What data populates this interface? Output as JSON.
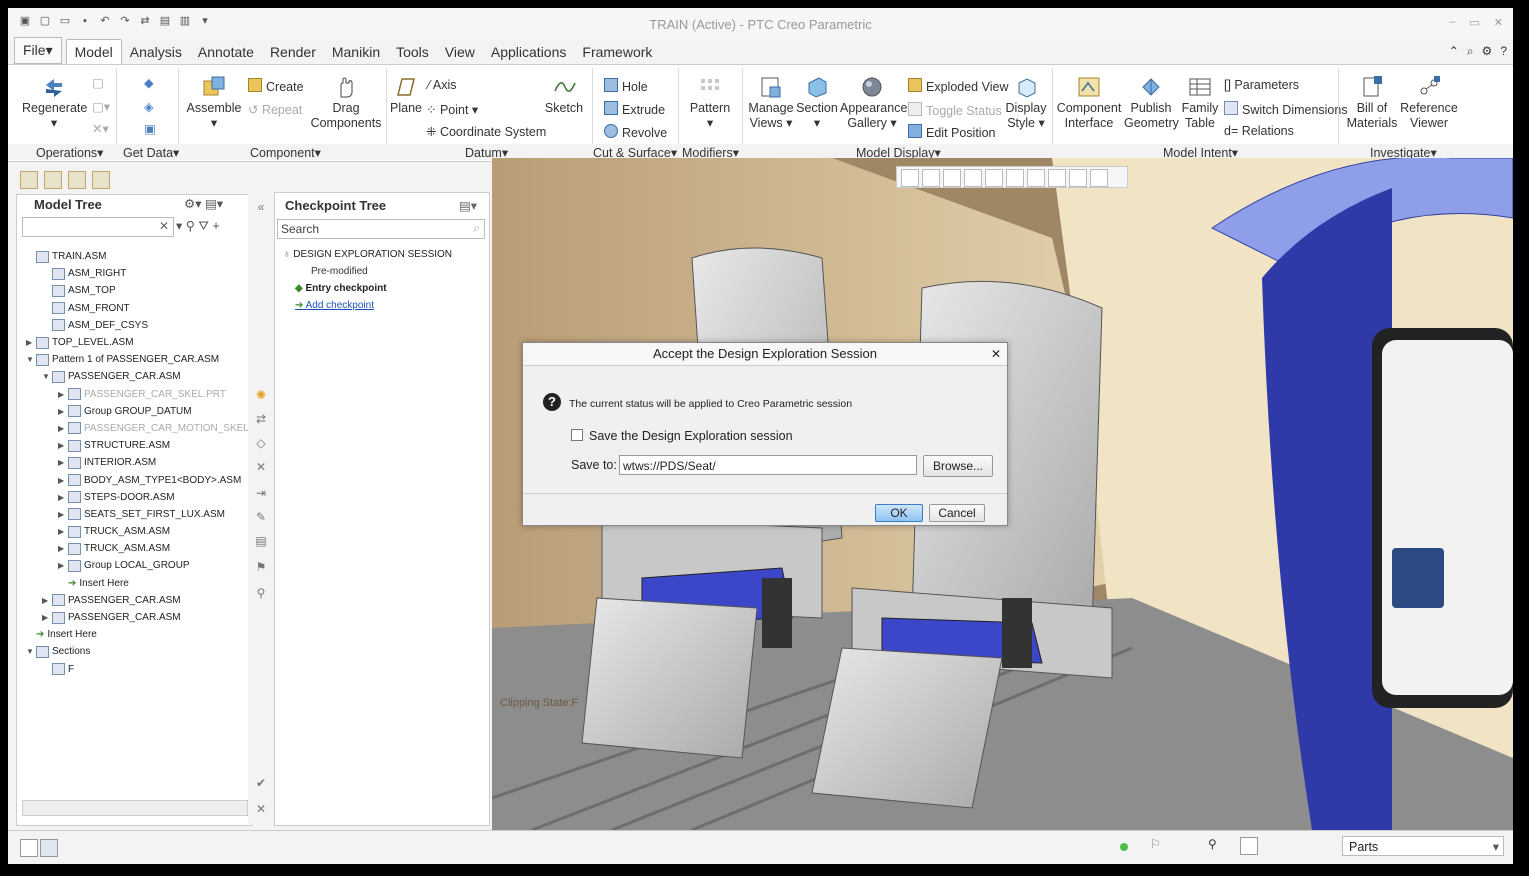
{
  "window": {
    "title": "TRAIN (Active) - PTC Creo Parametric"
  },
  "tabs": [
    "File",
    "Model",
    "Analysis",
    "Annotate",
    "Render",
    "Manikin",
    "Tools",
    "View",
    "Applications",
    "Framework"
  ],
  "ribbon": {
    "regenerate": "Regenerate",
    "assemble": "Assemble",
    "create": "Create",
    "repeat": "Repeat",
    "drag": "Drag",
    "components": "Components",
    "plane": "Plane",
    "axis": "Axis",
    "point": "Point",
    "coordinate_system": "Coordinate System",
    "sketch": "Sketch",
    "hole": "Hole",
    "extrude": "Extrude",
    "revolve": "Revolve",
    "pattern": "Pattern",
    "manage": "Manage",
    "views": "Views",
    "section": "Section",
    "appearance": "Appearance",
    "gallery": "Gallery",
    "exploded_view": "Exploded View",
    "toggle_status": "Toggle Status",
    "edit_position": "Edit Position",
    "display": "Display",
    "style": "Style",
    "component": "Component",
    "interface": "Interface",
    "publish": "Publish",
    "geometry": "Geometry",
    "family": "Family",
    "table": "Table",
    "parameters": "Parameters",
    "switch_dimensions": "Switch Dimensions",
    "relations": "Relations",
    "bill_of": "Bill of",
    "materials": "Materials",
    "reference": "Reference",
    "viewer": "Viewer"
  },
  "groups": {
    "operations": "Operations",
    "get_data": "Get Data",
    "component": "Component",
    "datum": "Datum",
    "cut_surface": "Cut & Surface",
    "modifiers": "Modifiers",
    "model_display": "Model Display",
    "model_intent": "Model Intent",
    "investigate": "Investigate"
  },
  "model_tree": {
    "title": "Model Tree",
    "items": [
      {
        "label": "TRAIN.ASM",
        "indent": 0,
        "toggle": "",
        "grey": false
      },
      {
        "label": "ASM_RIGHT",
        "indent": 1,
        "toggle": "",
        "grey": false
      },
      {
        "label": "ASM_TOP",
        "indent": 1,
        "toggle": "",
        "grey": false
      },
      {
        "label": "ASM_FRONT",
        "indent": 1,
        "toggle": "",
        "grey": false
      },
      {
        "label": "ASM_DEF_CSYS",
        "indent": 1,
        "toggle": "",
        "grey": false
      },
      {
        "label": "TOP_LEVEL.ASM",
        "indent": 0,
        "toggle": "▶",
        "grey": false
      },
      {
        "label": "Pattern 1 of PASSENGER_CAR.ASM",
        "indent": 0,
        "toggle": "▼",
        "grey": false
      },
      {
        "label": "PASSENGER_CAR.ASM",
        "indent": 1,
        "toggle": "▼",
        "grey": false
      },
      {
        "label": "PASSENGER_CAR_SKEL.PRT",
        "indent": 2,
        "toggle": "▶",
        "grey": true
      },
      {
        "label": "Group GROUP_DATUM",
        "indent": 2,
        "toggle": "▶",
        "grey": false
      },
      {
        "label": "PASSENGER_CAR_MOTION_SKEL",
        "indent": 2,
        "toggle": "▶",
        "grey": true
      },
      {
        "label": "STRUCTURE.ASM",
        "indent": 2,
        "toggle": "▶",
        "grey": false
      },
      {
        "label": "INTERIOR.ASM",
        "indent": 2,
        "toggle": "▶",
        "grey": false
      },
      {
        "label": "BODY_ASM_TYPE1<BODY>.ASM",
        "indent": 2,
        "toggle": "▶",
        "grey": false
      },
      {
        "label": "STEPS-DOOR.ASM",
        "indent": 2,
        "toggle": "▶",
        "grey": false
      },
      {
        "label": "SEATS_SET_FIRST_LUX.ASM",
        "indent": 2,
        "toggle": "▶",
        "grey": false
      },
      {
        "label": "TRUCK_ASM.ASM",
        "indent": 2,
        "toggle": "▶",
        "grey": false
      },
      {
        "label": "TRUCK_ASM.ASM",
        "indent": 2,
        "toggle": "▶",
        "grey": false
      },
      {
        "label": "Group LOCAL_GROUP",
        "indent": 2,
        "toggle": "▶",
        "grey": false
      },
      {
        "label": "Insert Here",
        "indent": 2,
        "toggle": "",
        "grey": false,
        "insert": true
      },
      {
        "label": "PASSENGER_CAR.ASM",
        "indent": 1,
        "toggle": "▶",
        "grey": false
      },
      {
        "label": "PASSENGER_CAR.ASM",
        "indent": 1,
        "toggle": "▶",
        "grey": false
      },
      {
        "label": "Insert Here",
        "indent": 0,
        "toggle": "",
        "grey": false,
        "insert": true
      },
      {
        "label": "Sections",
        "indent": 0,
        "toggle": "▼",
        "grey": false
      },
      {
        "label": "F",
        "indent": 1,
        "toggle": "",
        "grey": false
      }
    ]
  },
  "checkpoint_tree": {
    "title": "Checkpoint Tree",
    "search_placeholder": "Search",
    "session": "DESIGN EXPLORATION SESSION",
    "pre_modified": "Pre-modified",
    "entry": "Entry checkpoint",
    "add": "Add checkpoint"
  },
  "dialog": {
    "title": "Accept the Design Exploration Session",
    "message": "The current status will be applied to Creo Parametric session",
    "checkbox_label": "Save the Design Exploration session",
    "save_to_label": "Save to:",
    "save_to_value": "wtws://PDS/Seat/",
    "browse": "Browse...",
    "ok": "OK",
    "cancel": "Cancel"
  },
  "viewport": {
    "clipping_state": "Clipping State:F"
  },
  "statusbar": {
    "filter": "Parts"
  }
}
